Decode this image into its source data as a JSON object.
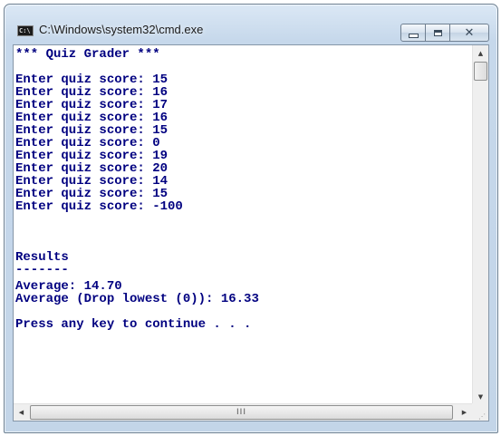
{
  "window": {
    "title": "C:\\Windows\\system32\\cmd.exe",
    "icon_label": "C:\\",
    "icon": "console-app-icon"
  },
  "caption_buttons": {
    "minimize_icon": "minimize-icon",
    "maximize_icon": "maximize-icon",
    "close_icon": "close-icon",
    "close_glyph": "✕"
  },
  "console": {
    "lines": [
      "*** Quiz Grader ***",
      "",
      "Enter quiz score: 15",
      "Enter quiz score: 16",
      "Enter quiz score: 17",
      "Enter quiz score: 16",
      "Enter quiz score: 15",
      "Enter quiz score: 0",
      "Enter quiz score: 19",
      "Enter quiz score: 20",
      "Enter quiz score: 14",
      "Enter quiz score: 15",
      "Enter quiz score: -100",
      "",
      "",
      "Results",
      "-------",
      "Average: 14.70",
      "Average (Drop lowest (0)): 16.33",
      "",
      "Press any key to continue . . ."
    ],
    "text_color": "#000080",
    "background": "#ffffff"
  },
  "scrollbars": {
    "up_arrow": "▲",
    "down_arrow": "▼",
    "left_arrow": "◀",
    "right_arrow": "▶",
    "grip": "III",
    "resize_grip": "⋰"
  }
}
